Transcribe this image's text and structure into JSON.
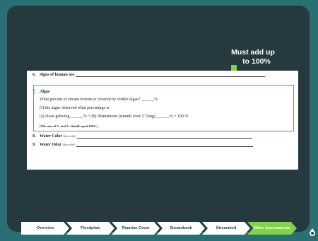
{
  "callout": {
    "line1": "Must add up",
    "line2": "to 100%"
  },
  "form": {
    "item6": {
      "number": "6.",
      "title": "Signs of human use"
    },
    "item7": {
      "number": "7.",
      "title": "Algae",
      "q1": "What percent of stream bottom is covered by visible algae? ______%",
      "q2": "Of the algae observed what percentage is",
      "q3": "(a) close-growing ______% + (b) filamentous (strands over 2\" long) ______% = 100 %",
      "note": "(The sum of % and % should equal 100%)"
    },
    "item8": {
      "number": "8.",
      "title": "Water Color",
      "hint": "(describe)"
    },
    "item9": {
      "number": "9.",
      "title": "Water Odor",
      "hint": "(describe)"
    }
  },
  "nav": {
    "tabs": [
      {
        "label": "Overview"
      },
      {
        "label": "Floodplain"
      },
      {
        "label": "Riparian Cover"
      },
      {
        "label": "Streambank"
      },
      {
        "label": "Streambed"
      },
      {
        "label": "Other Assessments"
      }
    ]
  },
  "colors": {
    "accent": "#7fd24a",
    "highlight": "#2fb36f",
    "frame": "#2a6f73",
    "slide": "#25393f"
  },
  "icons": {
    "logo": "water-drop-logo-icon"
  }
}
